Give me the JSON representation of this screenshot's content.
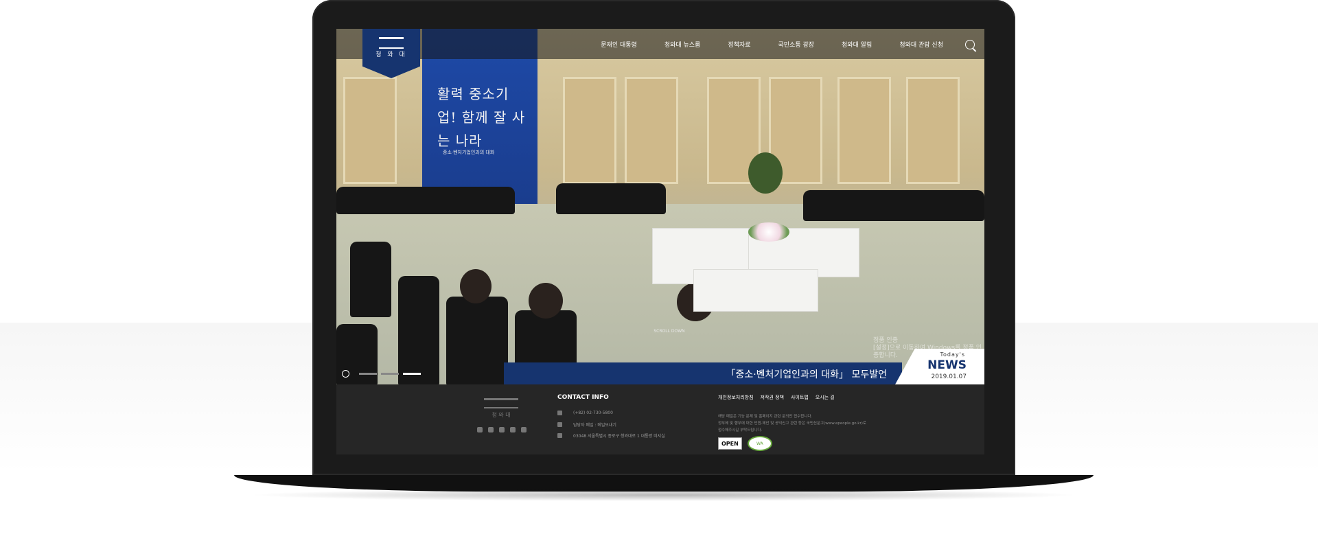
{
  "logo": {
    "label": "청 와 대"
  },
  "nav": {
    "items": [
      "문재인 대통령",
      "청와대 뉴스룸",
      "정책자료",
      "국민소통 광장",
      "청와대 알림",
      "청와대 관람 신청"
    ]
  },
  "hero": {
    "banner_calligraphy": "활력 중소기업! 함께 잘 사는 나라",
    "banner_subtitle": "중소·벤처기업인과의 대화",
    "scroll_hint": "SCROLL DOWN",
    "watermark_line1": "정품 인증",
    "watermark_line2": "[설정]으로 이동하여 Windows를 정품 인증합니다."
  },
  "news": {
    "headline": "「중소·벤처기업인과의 대화」 모두발언",
    "today_label": "Today's",
    "news_label": "NEWS",
    "date": "2019.01.07"
  },
  "footer": {
    "logo_text": "청 와 대",
    "contact_title": "CONTACT INFO",
    "phone": "(+82) 02-730-5800",
    "email_label": "담당자 메일 : 메일보내기",
    "address": "03048 서울특별시 종로구 청와대로 1 대통령 비서실",
    "links": [
      "개인정보처리방침",
      "저작권 정책",
      "사이트맵",
      "오시는 길"
    ],
    "note1": "해당 메일은 기능 문제 및 홈페이지 관련 문의만 접수합니다.",
    "note2": "정부에 및 행부에 대한 민원·제안 및 공익신고 관련 등은 국민신문고(www.epeople.go.kr)로",
    "note3": "접수해주시길 부탁드립니다.",
    "badge_open": "OPEN",
    "badge_wa": "WA"
  },
  "colors": {
    "accent": "#16346f",
    "banner": "#1e4aa8",
    "footer_bg": "#262626"
  }
}
